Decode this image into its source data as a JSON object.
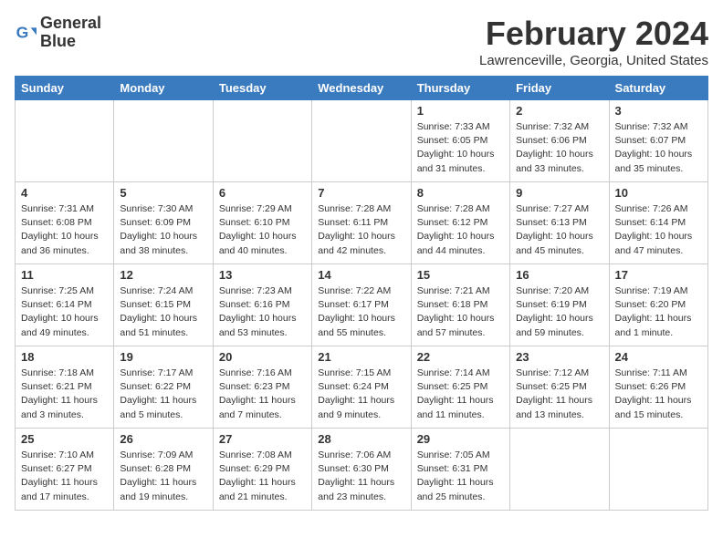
{
  "logo": {
    "line1": "General",
    "line2": "Blue"
  },
  "title": "February 2024",
  "location": "Lawrenceville, Georgia, United States",
  "days_of_week": [
    "Sunday",
    "Monday",
    "Tuesday",
    "Wednesday",
    "Thursday",
    "Friday",
    "Saturday"
  ],
  "weeks": [
    [
      {
        "num": "",
        "info": ""
      },
      {
        "num": "",
        "info": ""
      },
      {
        "num": "",
        "info": ""
      },
      {
        "num": "",
        "info": ""
      },
      {
        "num": "1",
        "info": "Sunrise: 7:33 AM\nSunset: 6:05 PM\nDaylight: 10 hours and 31 minutes."
      },
      {
        "num": "2",
        "info": "Sunrise: 7:32 AM\nSunset: 6:06 PM\nDaylight: 10 hours and 33 minutes."
      },
      {
        "num": "3",
        "info": "Sunrise: 7:32 AM\nSunset: 6:07 PM\nDaylight: 10 hours and 35 minutes."
      }
    ],
    [
      {
        "num": "4",
        "info": "Sunrise: 7:31 AM\nSunset: 6:08 PM\nDaylight: 10 hours and 36 minutes."
      },
      {
        "num": "5",
        "info": "Sunrise: 7:30 AM\nSunset: 6:09 PM\nDaylight: 10 hours and 38 minutes."
      },
      {
        "num": "6",
        "info": "Sunrise: 7:29 AM\nSunset: 6:10 PM\nDaylight: 10 hours and 40 minutes."
      },
      {
        "num": "7",
        "info": "Sunrise: 7:28 AM\nSunset: 6:11 PM\nDaylight: 10 hours and 42 minutes."
      },
      {
        "num": "8",
        "info": "Sunrise: 7:28 AM\nSunset: 6:12 PM\nDaylight: 10 hours and 44 minutes."
      },
      {
        "num": "9",
        "info": "Sunrise: 7:27 AM\nSunset: 6:13 PM\nDaylight: 10 hours and 45 minutes."
      },
      {
        "num": "10",
        "info": "Sunrise: 7:26 AM\nSunset: 6:14 PM\nDaylight: 10 hours and 47 minutes."
      }
    ],
    [
      {
        "num": "11",
        "info": "Sunrise: 7:25 AM\nSunset: 6:14 PM\nDaylight: 10 hours and 49 minutes."
      },
      {
        "num": "12",
        "info": "Sunrise: 7:24 AM\nSunset: 6:15 PM\nDaylight: 10 hours and 51 minutes."
      },
      {
        "num": "13",
        "info": "Sunrise: 7:23 AM\nSunset: 6:16 PM\nDaylight: 10 hours and 53 minutes."
      },
      {
        "num": "14",
        "info": "Sunrise: 7:22 AM\nSunset: 6:17 PM\nDaylight: 10 hours and 55 minutes."
      },
      {
        "num": "15",
        "info": "Sunrise: 7:21 AM\nSunset: 6:18 PM\nDaylight: 10 hours and 57 minutes."
      },
      {
        "num": "16",
        "info": "Sunrise: 7:20 AM\nSunset: 6:19 PM\nDaylight: 10 hours and 59 minutes."
      },
      {
        "num": "17",
        "info": "Sunrise: 7:19 AM\nSunset: 6:20 PM\nDaylight: 11 hours and 1 minute."
      }
    ],
    [
      {
        "num": "18",
        "info": "Sunrise: 7:18 AM\nSunset: 6:21 PM\nDaylight: 11 hours and 3 minutes."
      },
      {
        "num": "19",
        "info": "Sunrise: 7:17 AM\nSunset: 6:22 PM\nDaylight: 11 hours and 5 minutes."
      },
      {
        "num": "20",
        "info": "Sunrise: 7:16 AM\nSunset: 6:23 PM\nDaylight: 11 hours and 7 minutes."
      },
      {
        "num": "21",
        "info": "Sunrise: 7:15 AM\nSunset: 6:24 PM\nDaylight: 11 hours and 9 minutes."
      },
      {
        "num": "22",
        "info": "Sunrise: 7:14 AM\nSunset: 6:25 PM\nDaylight: 11 hours and 11 minutes."
      },
      {
        "num": "23",
        "info": "Sunrise: 7:12 AM\nSunset: 6:25 PM\nDaylight: 11 hours and 13 minutes."
      },
      {
        "num": "24",
        "info": "Sunrise: 7:11 AM\nSunset: 6:26 PM\nDaylight: 11 hours and 15 minutes."
      }
    ],
    [
      {
        "num": "25",
        "info": "Sunrise: 7:10 AM\nSunset: 6:27 PM\nDaylight: 11 hours and 17 minutes."
      },
      {
        "num": "26",
        "info": "Sunrise: 7:09 AM\nSunset: 6:28 PM\nDaylight: 11 hours and 19 minutes."
      },
      {
        "num": "27",
        "info": "Sunrise: 7:08 AM\nSunset: 6:29 PM\nDaylight: 11 hours and 21 minutes."
      },
      {
        "num": "28",
        "info": "Sunrise: 7:06 AM\nSunset: 6:30 PM\nDaylight: 11 hours and 23 minutes."
      },
      {
        "num": "29",
        "info": "Sunrise: 7:05 AM\nSunset: 6:31 PM\nDaylight: 11 hours and 25 minutes."
      },
      {
        "num": "",
        "info": ""
      },
      {
        "num": "",
        "info": ""
      }
    ]
  ]
}
